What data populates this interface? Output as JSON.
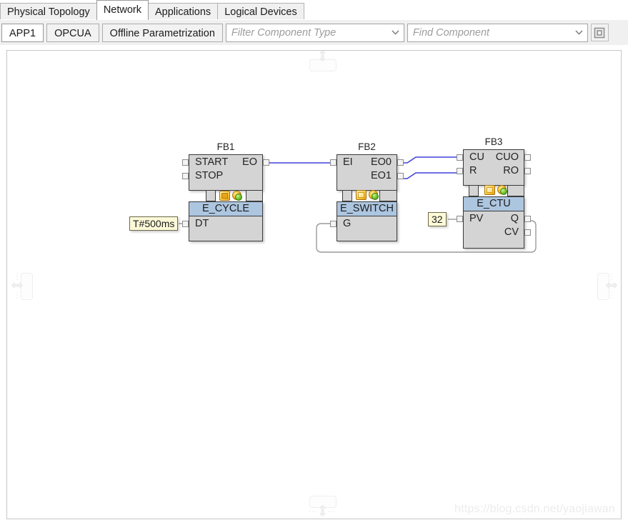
{
  "window": {
    "watermark": "https://blog.csdn.net/yaojiawan"
  },
  "main_tabs": [
    {
      "label": "Physical Topology",
      "active": false
    },
    {
      "label": "Network",
      "active": true
    },
    {
      "label": "Applications",
      "active": false
    },
    {
      "label": "Logical Devices",
      "active": false
    }
  ],
  "toolbar": {
    "sub_tabs": [
      {
        "label": "APP1",
        "selected": true
      },
      {
        "label": "OPCUA",
        "selected": false
      },
      {
        "label": "Offline Parametrization",
        "selected": false
      }
    ],
    "filter_combo": {
      "placeholder": "Filter Component Type",
      "value": "",
      "icon": "chevron-down-icon"
    },
    "find_combo": {
      "placeholder": "Find Component",
      "value": "",
      "icon": "chevron-down-icon"
    },
    "overview_button": {
      "icon": "overview-square-icon",
      "tooltip": "Overview"
    }
  },
  "canvas": {
    "edge_handles": [
      {
        "name": "collapse-handle-top",
        "icon": "arrows-vertical-icon"
      },
      {
        "name": "collapse-handle-left",
        "icon": "arrows-horizontal-icon"
      },
      {
        "name": "collapse-handle-right",
        "icon": "arrows-horizontal-icon"
      },
      {
        "name": "collapse-handle-bottom",
        "icon": "arrows-vertical-icon"
      }
    ],
    "blocks": [
      {
        "instance": "FB1",
        "type": "E_CYCLE",
        "event_inputs": [
          "START",
          "STOP"
        ],
        "event_outputs": [
          "EO"
        ],
        "data_inputs": [
          "DT"
        ],
        "data_outputs": [],
        "icons": [
          "chip-icon",
          "sphere-icon"
        ]
      },
      {
        "instance": "FB2",
        "type": "E_SWITCH",
        "event_inputs": [
          "EI"
        ],
        "event_outputs": [
          "EO0",
          "EO1"
        ],
        "data_inputs": [
          "G"
        ],
        "data_outputs": [],
        "icons": [
          "chip-icon",
          "sphere-icon"
        ]
      },
      {
        "instance": "FB3",
        "type": "E_CTU",
        "event_inputs": [
          "CU",
          "R"
        ],
        "event_outputs": [
          "CUO",
          "RO"
        ],
        "data_inputs": [
          "PV"
        ],
        "data_outputs": [
          "Q",
          "CV"
        ],
        "icons": [
          "chip-icon",
          "sphere-icon"
        ]
      }
    ],
    "literals": [
      {
        "name": "literal-dt",
        "value": "T#500ms",
        "target": "FB1.DT"
      },
      {
        "name": "literal-pv",
        "value": "32",
        "target": "FB3.PV"
      }
    ],
    "connections": [
      {
        "from": "FB1.EO",
        "to": "FB2.EI",
        "kind": "event"
      },
      {
        "from": "FB2.EO0",
        "to": "FB3.CU",
        "kind": "event"
      },
      {
        "from": "FB2.EO1",
        "to": "FB3.R",
        "kind": "event"
      },
      {
        "from": "FB3.Q",
        "to": "FB2.G",
        "kind": "data"
      }
    ]
  },
  "colors": {
    "event_wire": "#4040d8",
    "data_wire": "#9a9a9a",
    "block_body": "#d4d4d4",
    "type_bar": "#adc6e0",
    "literal_bg": "#fdf9d8"
  }
}
